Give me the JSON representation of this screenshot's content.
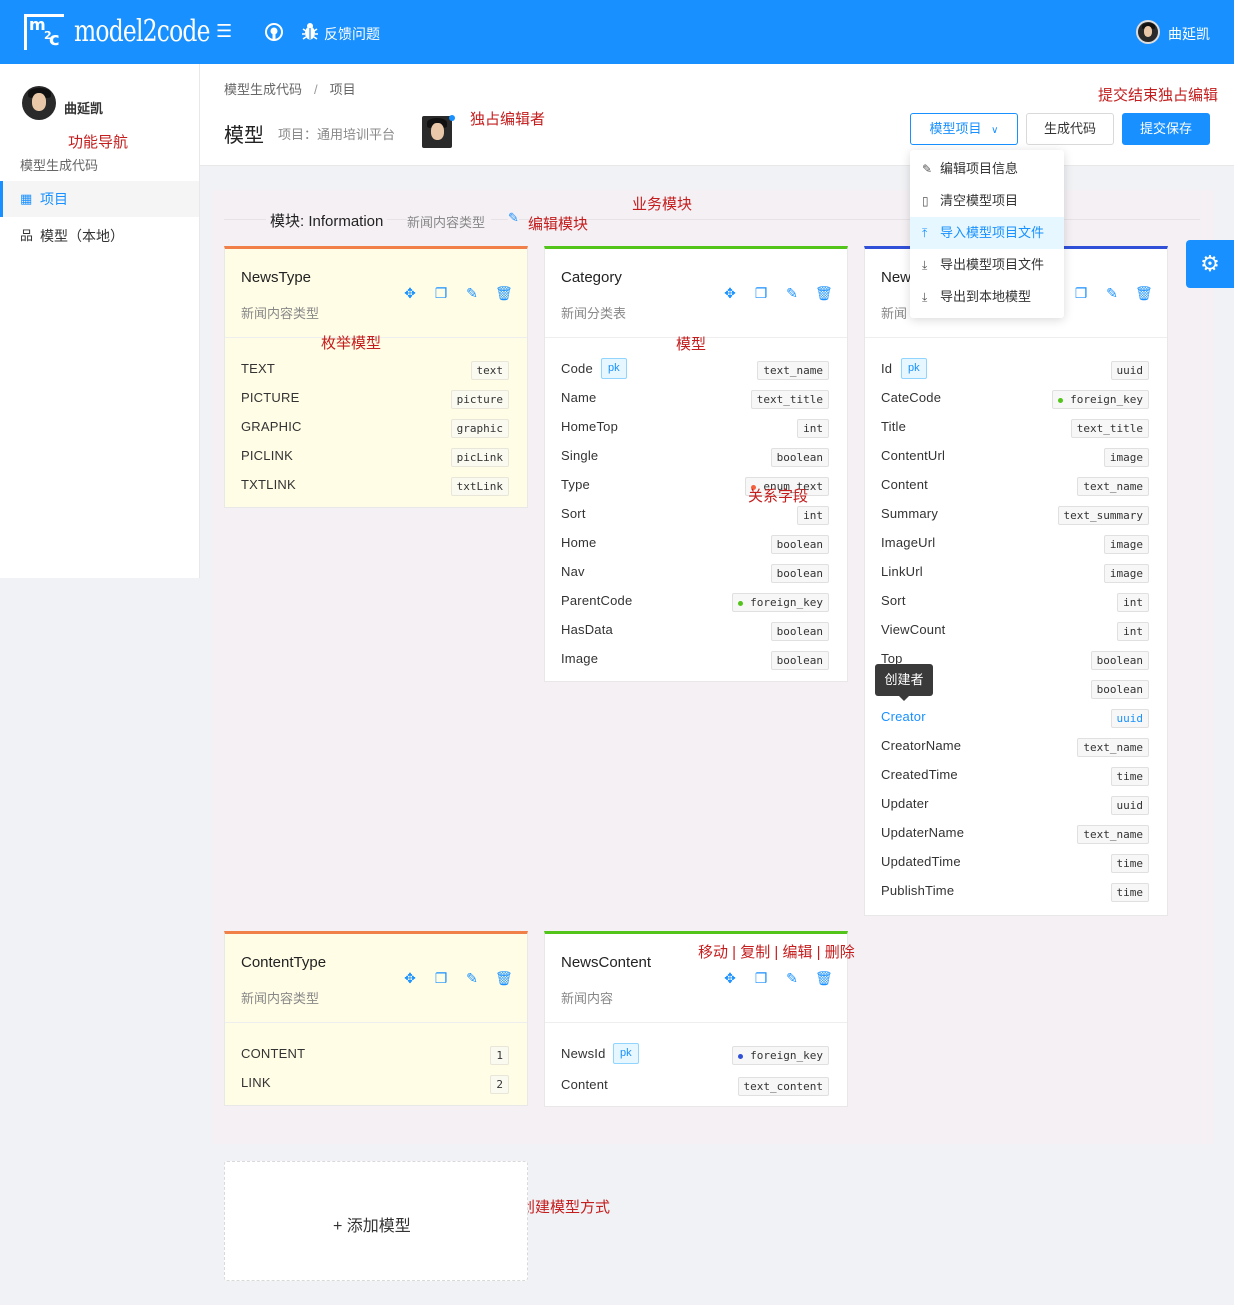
{
  "header": {
    "logo_text": "model2code",
    "feedback": "反馈问题",
    "user": "曲延凯"
  },
  "sidebar": {
    "user": "曲延凯",
    "subtitle": "模型生成代码",
    "items": [
      {
        "label": "项目"
      },
      {
        "label": "模型（本地）"
      }
    ]
  },
  "breadcrumb": [
    "模型生成代码",
    "项目"
  ],
  "page": {
    "title": "模型",
    "project_label": "项目：通用培训平台"
  },
  "actions": {
    "model_project": "模型项目",
    "generate": "生成代码",
    "submit": "提交保存"
  },
  "dropdown": [
    "编辑项目信息",
    "清空模型项目",
    "导入模型项目文件",
    "导出模型项目文件",
    "导出到本地模型"
  ],
  "module": {
    "title": "模块: Information",
    "desc": "新闻内容类型"
  },
  "annotations": {
    "editor": "独占编辑者",
    "submit_note": "提交结束独占编辑",
    "nav": "功能导航",
    "business": "业务模块",
    "edit_module": "编辑模块",
    "enum_model": "枚举模型",
    "model": "模型",
    "relation": "关系字段",
    "ops": "移动 | 复制 | 编辑 | 删除",
    "same_way": "同种创建模型方式"
  },
  "tooltip": "创建者",
  "add_model": "+ 添加模型",
  "colors": {
    "primary": "#1890ff",
    "enum_bg": "#fffde6",
    "annotation": "#c41d1d"
  },
  "cards": [
    {
      "name": "NewsType",
      "desc": "新闻内容类型",
      "fields": [
        {
          "name": "TEXT",
          "type": "text"
        },
        {
          "name": "PICTURE",
          "type": "picture"
        },
        {
          "name": "GRAPHIC",
          "type": "graphic"
        },
        {
          "name": "PICLINK",
          "type": "picLink"
        },
        {
          "name": "TXTLINK",
          "type": "txtLink"
        }
      ]
    },
    {
      "name": "Category",
      "desc": "新闻分类表",
      "fields": [
        {
          "name": "Code",
          "type": "text_name",
          "pk": "pk"
        },
        {
          "name": "Name",
          "type": "text_title"
        },
        {
          "name": "HomeTop",
          "type": "int"
        },
        {
          "name": "Single",
          "type": "boolean"
        },
        {
          "name": "Type",
          "type": "enum_text"
        },
        {
          "name": "Sort",
          "type": "int"
        },
        {
          "name": "Home",
          "type": "boolean"
        },
        {
          "name": "Nav",
          "type": "boolean"
        },
        {
          "name": "ParentCode",
          "type": "foreign_key"
        },
        {
          "name": "HasData",
          "type": "boolean"
        },
        {
          "name": "Image",
          "type": "boolean"
        }
      ]
    },
    {
      "name": "New",
      "desc": "新闻",
      "fields": [
        {
          "name": "Id",
          "type": "uuid",
          "pk": "pk"
        },
        {
          "name": "CateCode",
          "type": "foreign_key"
        },
        {
          "name": "Title",
          "type": "text_title"
        },
        {
          "name": "ContentUrl",
          "type": "image"
        },
        {
          "name": "Content",
          "type": "text_name"
        },
        {
          "name": "Summary",
          "type": "text_summary"
        },
        {
          "name": "ImageUrl",
          "type": "image"
        },
        {
          "name": "LinkUrl",
          "type": "image"
        },
        {
          "name": "Sort",
          "type": "int"
        },
        {
          "name": "ViewCount",
          "type": "int"
        },
        {
          "name": "Top",
          "type": "boolean"
        },
        {
          "name": "",
          "type": "boolean"
        },
        {
          "name": "Creator",
          "type": "uuid"
        },
        {
          "name": "CreatorName",
          "type": "text_name"
        },
        {
          "name": "CreatedTime",
          "type": "time"
        },
        {
          "name": "Updater",
          "type": "uuid"
        },
        {
          "name": "UpdaterName",
          "type": "text_name"
        },
        {
          "name": "UpdatedTime",
          "type": "time"
        },
        {
          "name": "PublishTime",
          "type": "time"
        }
      ]
    },
    {
      "name": "ContentType",
      "desc": "新闻内容类型",
      "fields": [
        {
          "name": "CONTENT",
          "type": "1"
        },
        {
          "name": "LINK",
          "type": "2"
        }
      ]
    },
    {
      "name": "NewsContent",
      "desc": "新闻内容",
      "fields": [
        {
          "name": "NewsId",
          "type": "foreign_key",
          "pk": "pk"
        },
        {
          "name": "Content",
          "type": "text_content"
        }
      ]
    }
  ]
}
